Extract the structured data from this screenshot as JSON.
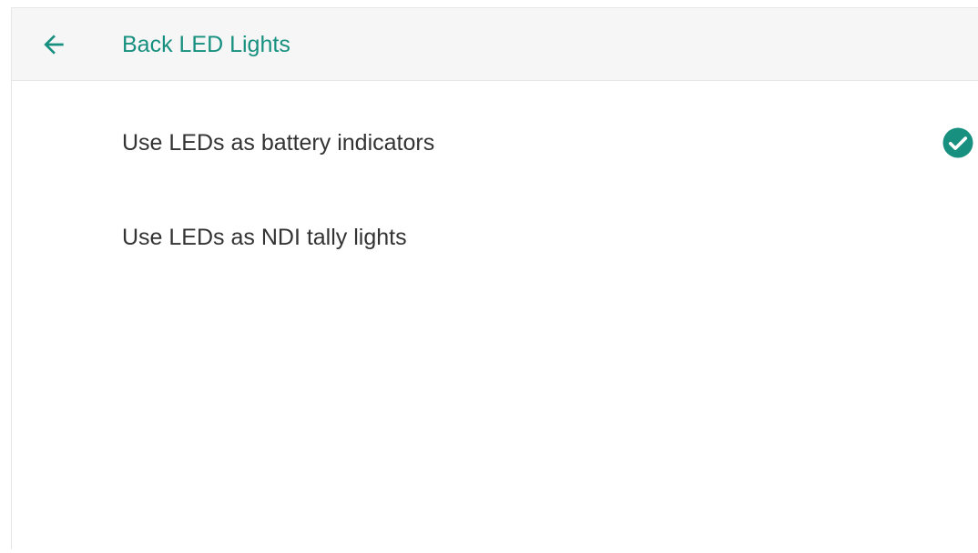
{
  "header": {
    "back_icon": "arrow-left-icon",
    "title": "Back LED Lights"
  },
  "options": [
    {
      "label": "Use LEDs as battery indicators",
      "selected": true,
      "icon": "check-circle-icon"
    },
    {
      "label": "Use LEDs as NDI tally lights",
      "selected": false
    }
  ],
  "colors": {
    "accent": "#17907f",
    "text": "#333333",
    "header_bg": "#f6f6f6"
  }
}
